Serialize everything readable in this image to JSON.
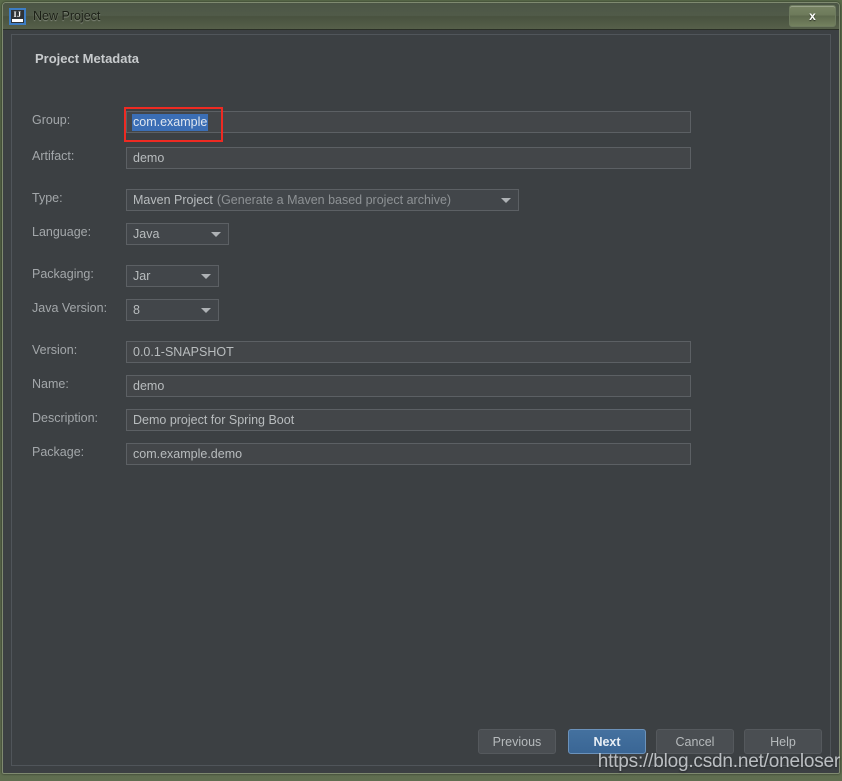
{
  "window": {
    "title": "New Project",
    "app_icon": "intellij-idea-icon",
    "close_label": "x"
  },
  "panel": {
    "section_title": "Project Metadata"
  },
  "form": {
    "fields": [
      {
        "id": "group",
        "label": "Group:",
        "value": "com.example",
        "kind": "text",
        "selected": true
      },
      {
        "id": "artifact",
        "label": "Artifact:",
        "value": "demo",
        "kind": "text",
        "selected": false
      },
      {
        "id": "type",
        "label": "Type:",
        "value": "Maven Project",
        "hint": "(Generate a Maven based project archive)",
        "kind": "combo"
      },
      {
        "id": "language",
        "label": "Language:",
        "value": "Java",
        "kind": "combo"
      },
      {
        "id": "packaging",
        "label": "Packaging:",
        "value": "Jar",
        "kind": "combo"
      },
      {
        "id": "javaversion",
        "label": "Java Version:",
        "value": "8",
        "kind": "combo"
      },
      {
        "id": "version",
        "label": "Version:",
        "value": "0.0.1-SNAPSHOT",
        "kind": "text",
        "selected": false
      },
      {
        "id": "name",
        "label": "Name:",
        "value": "demo",
        "kind": "text",
        "selected": false
      },
      {
        "id": "description",
        "label": "Description:",
        "value": "Demo project for Spring Boot",
        "kind": "text",
        "selected": false
      },
      {
        "id": "package",
        "label": "Package:",
        "value": "com.example.demo",
        "kind": "text",
        "selected": false
      }
    ]
  },
  "footer": {
    "previous_label": "Previous",
    "next_label": "Next",
    "cancel_label": "Cancel",
    "help_label": "Help"
  },
  "watermark": {
    "text": "https://blog.csdn.net/oneloser"
  },
  "colors": {
    "accent": "#3a6695",
    "annotation": "#ee2a22",
    "selection": "#3b6eb5",
    "panel_bg": "#3c4043",
    "titlebar": "#515b49"
  }
}
